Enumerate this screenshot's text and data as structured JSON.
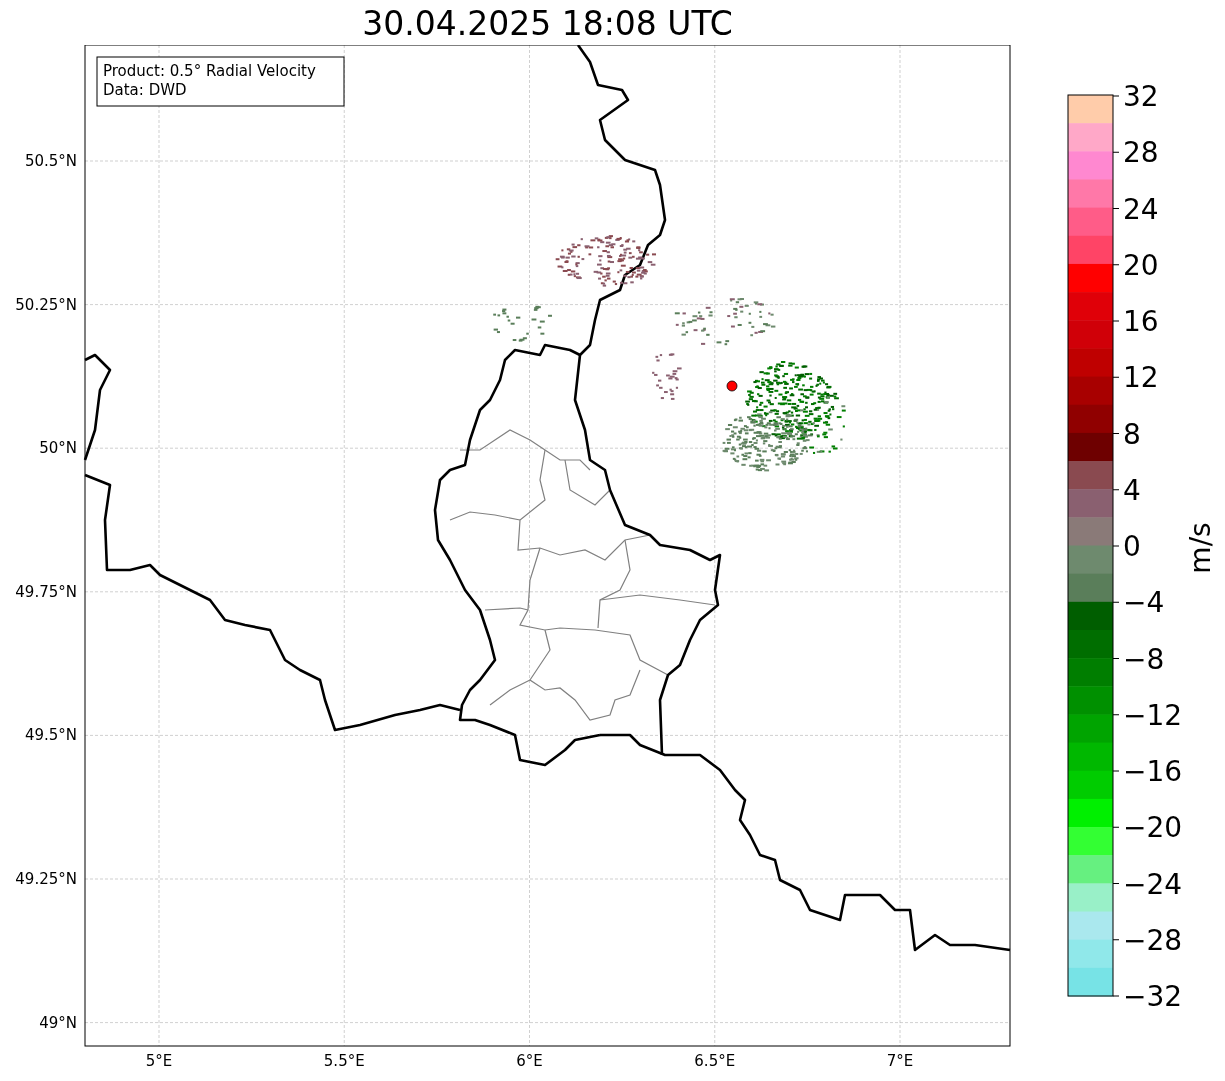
{
  "title": "30.04.2025 18:08 UTC",
  "info_box": [
    "Product: 0.5° Radial Velocity",
    "Data: DWD"
  ],
  "map": {
    "lat_labels": [
      "50.5°N",
      "50.25°N",
      "50°N",
      "49.75°N",
      "49.5°N",
      "49.25°N",
      "49°N"
    ],
    "lon_labels": [
      "5°E",
      "5.5°E",
      "6°E",
      "6.5°E",
      "7°E"
    ]
  },
  "colorbar": {
    "label": "m/s",
    "ticks": [
      "32",
      "28",
      "24",
      "20",
      "16",
      "12",
      "8",
      "4",
      "0",
      "−4",
      "−8",
      "−12",
      "−16",
      "−20",
      "−24",
      "−28",
      "−32"
    ]
  }
}
